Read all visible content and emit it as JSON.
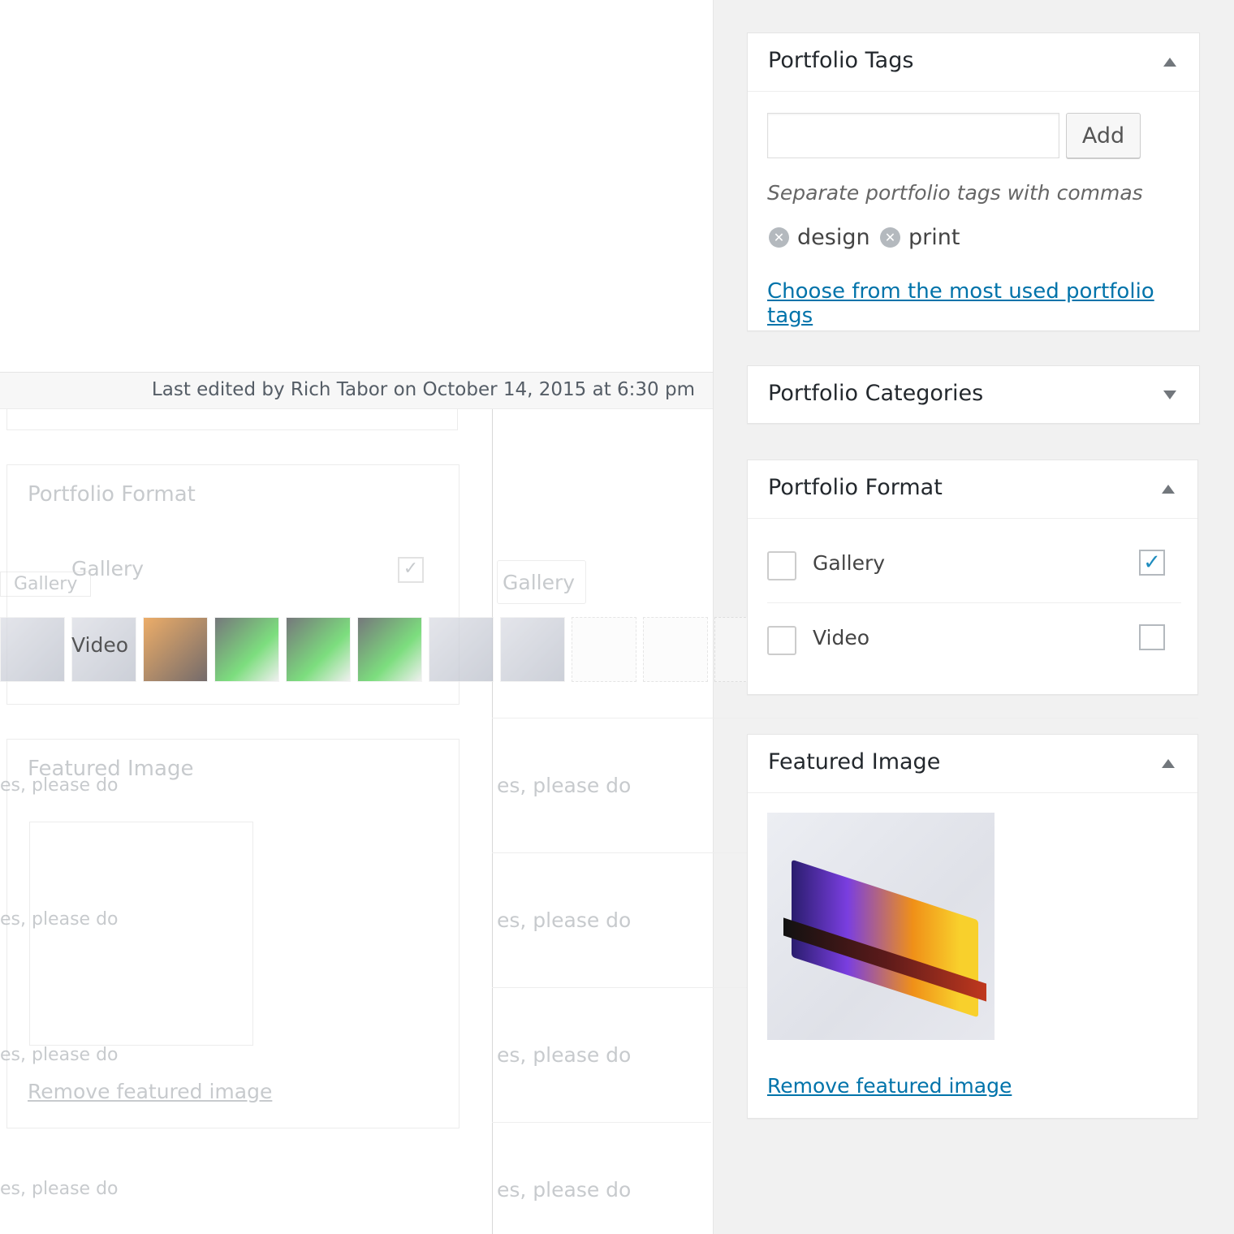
{
  "status": {
    "last_edited": "Last edited by Rich Tabor on October 14, 2015 at 6:30 pm"
  },
  "portfolio_tags": {
    "title": "Portfolio Tags",
    "add_label": "Add",
    "input_value": "",
    "help_text": "Separate portfolio tags with commas",
    "tags": [
      {
        "label": "design"
      },
      {
        "label": "print"
      }
    ],
    "most_used_link": "Choose from the most used portfolio tags"
  },
  "portfolio_categories": {
    "title": "Portfolio Categories"
  },
  "portfolio_format": {
    "title": "Portfolio Format",
    "options": [
      {
        "label": "Gallery",
        "checked": true
      },
      {
        "label": "Video",
        "checked": false
      }
    ]
  },
  "featured_image": {
    "title": "Featured Image",
    "remove_link": "Remove featured image"
  },
  "ghost": {
    "format_title": "Portfolio Format",
    "featured_title": "Featured Image",
    "gallery": "Gallery",
    "video": "Video",
    "gallery_button": "Gallery",
    "remove_link": "Remove featured image",
    "please_do": "es, please do",
    "categories_partial": "Portfolio Categories"
  },
  "colors": {
    "link": "#0073aa",
    "sidebar_bg": "#f1f1f1",
    "check": "#1e8cbe"
  }
}
